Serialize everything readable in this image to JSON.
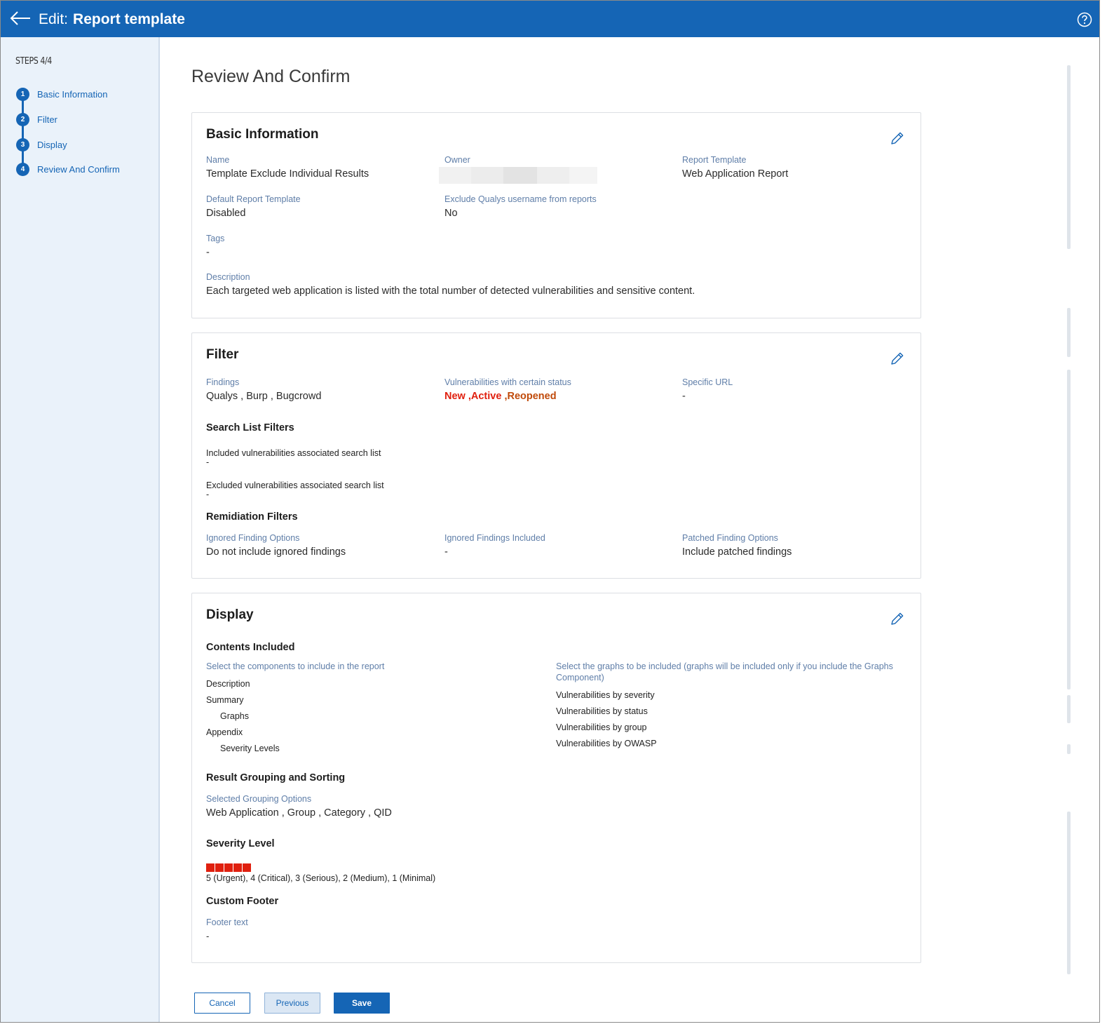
{
  "header": {
    "edit_label": "Edit:",
    "title": "Report template"
  },
  "sidebar": {
    "steps_label": "STEPS 4/4",
    "steps": [
      {
        "num": "1",
        "label": "Basic Information"
      },
      {
        "num": "2",
        "label": "Filter"
      },
      {
        "num": "3",
        "label": "Display"
      },
      {
        "num": "4",
        "label": "Review And Confirm"
      }
    ]
  },
  "page_title": "Review And Confirm",
  "basic_info": {
    "heading": "Basic Information",
    "name_label": "Name",
    "name_value": "Template Exclude Individual Results",
    "owner_label": "Owner",
    "report_template_label": "Report Template",
    "report_template_value": "Web Application Report",
    "default_label": "Default Report Template",
    "default_value": "Disabled",
    "exclude_label": "Exclude Qualys username from reports",
    "exclude_value": "No",
    "tags_label": "Tags",
    "tags_value": "-",
    "description_label": "Description",
    "description_value": "Each targeted web application is listed with the total number of detected vulnerabilities and sensitive content."
  },
  "filter": {
    "heading": "Filter",
    "findings_label": "Findings",
    "findings_value": "Qualys , Burp , Bugcrowd",
    "vuln_status_label": "Vulnerabilities with certain status",
    "status_new": "New",
    "status_active": " ,Active",
    "status_reopened": " ,Reopened",
    "specific_url_label": "Specific URL",
    "specific_url_value": "-",
    "search_list_heading": "Search List Filters",
    "included_label": "Included vulnerabilities associated search list",
    "included_value": "-",
    "excluded_label": "Excluded vulnerabilities associated search list",
    "excluded_value": "-",
    "remediation_heading": "Remidiation Filters",
    "ignored_options_label": "Ignored Finding Options",
    "ignored_options_value": "Do not include ignored findings",
    "ignored_included_label": "Ignored Findings Included",
    "ignored_included_value": "-",
    "patched_label": "Patched Finding Options",
    "patched_value": "Include patched findings"
  },
  "display": {
    "heading": "Display",
    "contents_heading": "Contents Included",
    "components_label": "Select the components to include in the report",
    "components": [
      "Description",
      "Summary",
      "Graphs",
      "Appendix",
      "Severity Levels"
    ],
    "graphs_label": "Select the graphs to be included (graphs will be included only if you include the Graphs Component)",
    "graphs": [
      "Vulnerabilities by severity",
      "Vulnerabilities by status",
      "Vulnerabilities by group",
      "Vulnerabilities by OWASP"
    ],
    "grouping_heading": "Result Grouping and Sorting",
    "grouping_label": "Selected Grouping Options",
    "grouping_value": "Web Application , Group , Category , QID",
    "severity_heading": "Severity Level",
    "severity_boxes": 5,
    "severity_color": "#e0200f",
    "severity_value": "5 (Urgent), 4 (Critical), 3 (Serious), 2 (Medium), 1 (Minimal)",
    "footer_heading": "Custom Footer",
    "footer_label": "Footer text",
    "footer_value": "-"
  },
  "buttons": {
    "cancel": "Cancel",
    "previous": "Previous",
    "save": "Save"
  },
  "colors": {
    "brand": "#1565b5",
    "label": "#5f7ea8",
    "status_red": "#e0200f",
    "status_orange": "#c04a0a"
  }
}
